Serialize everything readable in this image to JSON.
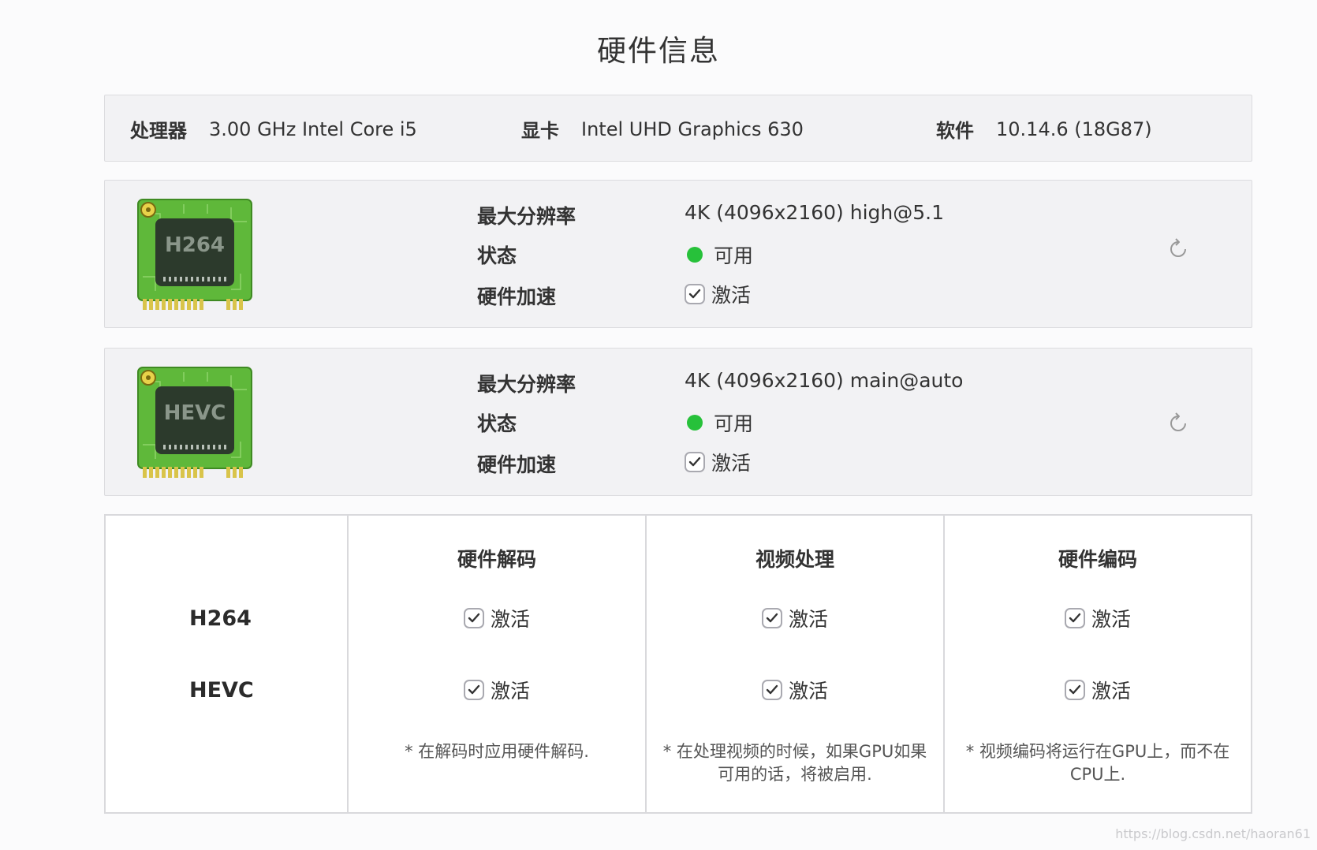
{
  "page": {
    "title": "硬件信息"
  },
  "system": {
    "cpu_label": "处理器",
    "cpu_value": "3.00 GHz Intel Core i5",
    "gpu_label": "显卡",
    "gpu_value": "Intel UHD Graphics 630",
    "software_label": "软件",
    "software_value": "10.14.6 (18G87)"
  },
  "codecs": [
    {
      "chip_label": "H264",
      "max_res_label": "最大分辨率",
      "max_res_value": "4K (4096x2160) high@5.1",
      "status_label": "状态",
      "status_value": "可用",
      "hw_accel_label": "硬件加速",
      "hw_accel_value": "激活",
      "hw_accel_checked": true
    },
    {
      "chip_label": "HEVC",
      "max_res_label": "最大分辨率",
      "max_res_value": "4K (4096x2160) main@auto",
      "status_label": "状态",
      "status_value": "可用",
      "hw_accel_label": "硬件加速",
      "hw_accel_value": "激活",
      "hw_accel_checked": true
    }
  ],
  "matrix": {
    "rows": [
      "H264",
      "HEVC"
    ],
    "columns": [
      {
        "header": "硬件解码",
        "cells": [
          "激活",
          "激活"
        ],
        "note": "* 在解码时应用硬件解码."
      },
      {
        "header": "视频处理",
        "cells": [
          "激活",
          "激活"
        ],
        "note": "* 在处理视频的时候，如果GPU如果可用的话，将被启用."
      },
      {
        "header": "硬件编码",
        "cells": [
          "激活",
          "激活"
        ],
        "note": "* 视频编码将运行在GPU上，而不在CPU上."
      }
    ]
  },
  "watermark": "https://blog.csdn.net/haoran61",
  "colors": {
    "status_green": "#27c13a",
    "chip_green": "#5fb83a"
  },
  "icons": {
    "refresh": "refresh-icon",
    "check": "checkmark-icon"
  }
}
